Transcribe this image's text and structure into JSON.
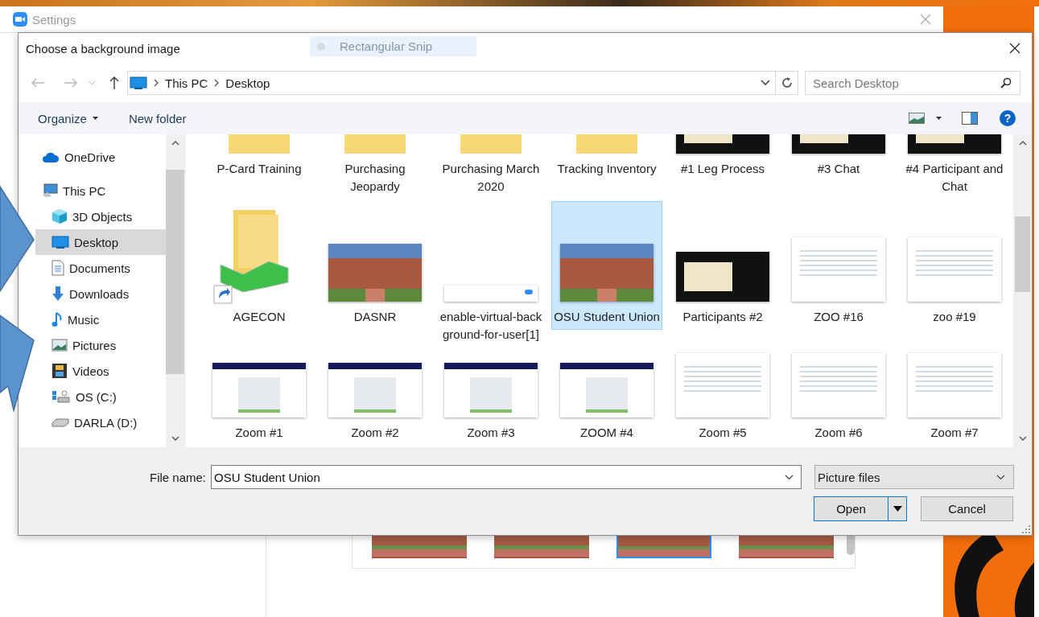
{
  "settings_window": {
    "title": "Settings"
  },
  "snip_overlay": {
    "label": "Rectangular Snip"
  },
  "dialog": {
    "title": "Choose a background image"
  },
  "breadcrumb": [
    "This PC",
    "Desktop"
  ],
  "search": {
    "placeholder": "Search Desktop"
  },
  "toolbar": {
    "organize": "Organize",
    "new_folder": "New folder",
    "help": "?"
  },
  "sidebar": [
    {
      "label": "OneDrive",
      "selected": false
    },
    {
      "label": "This PC",
      "selected": false,
      "children": [
        {
          "label": "3D Objects",
          "selected": false
        },
        {
          "label": "Desktop",
          "selected": true
        },
        {
          "label": "Documents",
          "selected": false
        },
        {
          "label": "Downloads",
          "selected": false
        },
        {
          "label": "Music",
          "selected": false
        },
        {
          "label": "Pictures",
          "selected": false
        },
        {
          "label": "Videos",
          "selected": false
        },
        {
          "label": "OS (C:)",
          "selected": false
        },
        {
          "label": "DARLA (D:)",
          "selected": false
        }
      ]
    }
  ],
  "files": [
    {
      "name": "P-Card Training",
      "kind": "folder",
      "selected": false
    },
    {
      "name": "Purchasing Jeopardy",
      "kind": "folder",
      "selected": false
    },
    {
      "name": "Purchasing March 2020",
      "kind": "folder",
      "selected": false
    },
    {
      "name": "Tracking Inventory",
      "kind": "folder",
      "selected": false
    },
    {
      "name": "#1 Leg Process",
      "kind": "dark-screenshot",
      "selected": false
    },
    {
      "name": "#3 Chat",
      "kind": "dark-screenshot",
      "selected": false
    },
    {
      "name": "#4 Participant and Chat",
      "kind": "dark-screenshot",
      "selected": false
    },
    {
      "name": "AGECON",
      "kind": "shortcut",
      "selected": false
    },
    {
      "name": "DASNR",
      "kind": "photo",
      "selected": false
    },
    {
      "name": "enable-virtual-background-for-user[1]",
      "kind": "banner-screenshot",
      "selected": false
    },
    {
      "name": "OSU Student Union",
      "kind": "photo",
      "selected": true
    },
    {
      "name": "Participants #2",
      "kind": "dark-screenshot",
      "selected": false
    },
    {
      "name": "ZOO #16",
      "kind": "screenshot",
      "selected": false
    },
    {
      "name": "zoo #19",
      "kind": "screenshot",
      "selected": false
    },
    {
      "name": "Zoom #1",
      "kind": "portal-screenshot",
      "selected": false
    },
    {
      "name": "Zoom #2",
      "kind": "portal-screenshot",
      "selected": false
    },
    {
      "name": "Zoom #3",
      "kind": "portal-screenshot",
      "selected": false
    },
    {
      "name": "ZOOM #4",
      "kind": "portal-screenshot",
      "selected": false
    },
    {
      "name": "Zoom #5",
      "kind": "screenshot",
      "selected": false
    },
    {
      "name": "Zoom #6",
      "kind": "screenshot",
      "selected": false
    },
    {
      "name": "Zoom #7",
      "kind": "screenshot",
      "selected": false
    }
  ],
  "file_name": {
    "label": "File name:",
    "value": "OSU Student Union"
  },
  "file_type": {
    "value": "Picture files"
  },
  "buttons": {
    "open": "Open",
    "cancel": "Cancel"
  },
  "background_thumbnails": [
    {
      "selected": false
    },
    {
      "selected": false
    },
    {
      "selected": true
    },
    {
      "selected": false
    }
  ]
}
